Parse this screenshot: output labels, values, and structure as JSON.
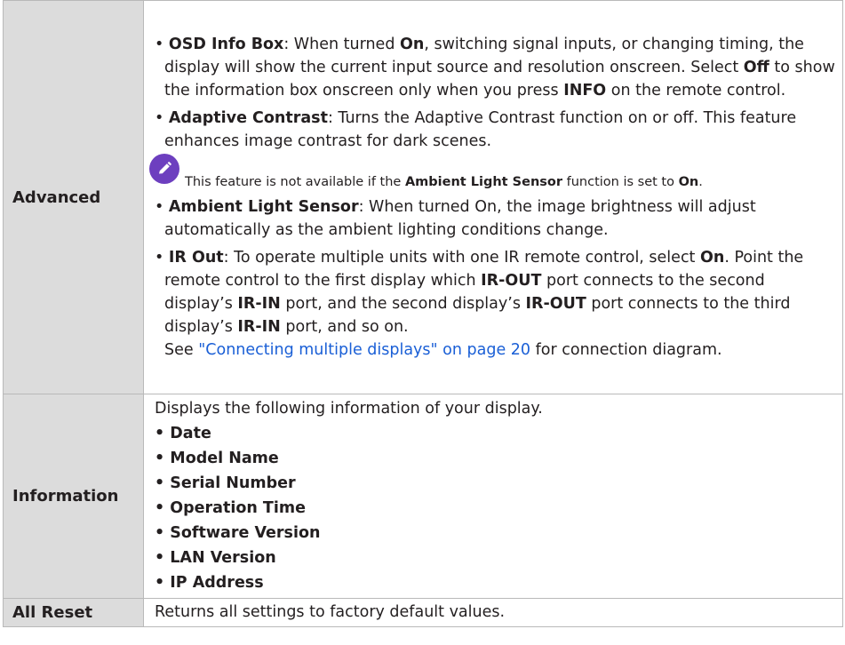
{
  "rows": {
    "advanced": {
      "label": "Advanced",
      "osd": {
        "title": "OSD Info Box",
        "t1": ": When turned ",
        "on1": "On",
        "t2": ", switching signal inputs, or changing timing, the display will show the current input source and resolution onscreen. Select ",
        "off": "Off",
        "t3": " to show the information box onscreen only when you press ",
        "info": "INFO",
        "t4": " on the remote control."
      },
      "adaptive": {
        "title": "Adaptive Contrast",
        "text": ": Turns the Adaptive Contrast function on or off. This feature enhances image contrast for dark scenes."
      },
      "note": {
        "icon": "pencil-icon",
        "t1": "This feature is not available if the ",
        "b1": "Ambient Light Sensor",
        "t2": " function is set to ",
        "b2": "On",
        "t3": "."
      },
      "ambient": {
        "title": "Ambient Light Sensor",
        "text": ": When turned On, the image brightness will adjust automatically as the ambient lighting conditions change."
      },
      "irout": {
        "title": "IR Out",
        "t1": ": To operate multiple units with one IR remote control, select ",
        "on": "On",
        "t2": ". Point the remote control to the first display which ",
        "b1": "IR-OUT",
        "t3": " port connects to the second display’s ",
        "b2": "IR-IN",
        "t4": " port, and the second display’s ",
        "b3": "IR-OUT",
        "t5": " port connects to the third display’s ",
        "b4": "IR-IN",
        "t6": " port, and so on.",
        "see": "See ",
        "link": "\"Connecting multiple displays\" on page 20",
        "after": " for connection diagram."
      }
    },
    "information": {
      "label": "Information",
      "intro": "Displays the following information of your display.",
      "items": [
        "Date",
        "Model Name",
        "Serial Number",
        "Operation Time",
        "Software Version",
        "LAN Version",
        "IP Address"
      ]
    },
    "all_reset": {
      "label": "All Reset",
      "text": "Returns all settings to factory default values."
    }
  },
  "colors": {
    "label_bg": "#dcdcdc",
    "border": "#b9b9b9",
    "note_icon": "#6d3fbf",
    "link": "#1a5fd6"
  }
}
